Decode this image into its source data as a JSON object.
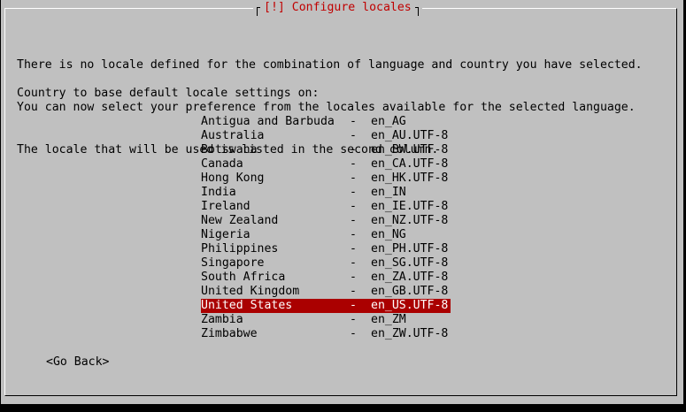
{
  "window": {
    "title": "[!] Configure locales"
  },
  "description": {
    "lines": [
      "There is no locale defined for the combination of language and country you have selected.",
      "You can now select your preference from the locales available for the selected language.",
      "The locale that will be used is listed in the second column."
    ]
  },
  "prompt": "Country to base default locale settings on:",
  "separator": "-",
  "locales": [
    {
      "country": "Antigua and Barbuda",
      "code": "en_AG"
    },
    {
      "country": "Australia",
      "code": "en_AU.UTF-8"
    },
    {
      "country": "Botswana",
      "code": "en_BW.UTF-8"
    },
    {
      "country": "Canada",
      "code": "en_CA.UTF-8"
    },
    {
      "country": "Hong Kong",
      "code": "en_HK.UTF-8"
    },
    {
      "country": "India",
      "code": "en_IN"
    },
    {
      "country": "Ireland",
      "code": "en_IE.UTF-8"
    },
    {
      "country": "New Zealand",
      "code": "en_NZ.UTF-8"
    },
    {
      "country": "Nigeria",
      "code": "en_NG"
    },
    {
      "country": "Philippines",
      "code": "en_PH.UTF-8"
    },
    {
      "country": "Singapore",
      "code": "en_SG.UTF-8"
    },
    {
      "country": "South Africa",
      "code": "en_ZA.UTF-8"
    },
    {
      "country": "United Kingdom",
      "code": "en_GB.UTF-8"
    },
    {
      "country": "United States",
      "code": "en_US.UTF-8"
    },
    {
      "country": "Zambia",
      "code": "en_ZM"
    },
    {
      "country": "Zimbabwe",
      "code": "en_ZW.UTF-8"
    }
  ],
  "selected_country": "United States",
  "buttons": {
    "go_back": "<Go Back>"
  },
  "colors": {
    "background": "#000000",
    "dialog": "#c0c0c0",
    "title": "#c00000",
    "highlight": "#aa0000",
    "highlight_text": "#ffffff"
  }
}
